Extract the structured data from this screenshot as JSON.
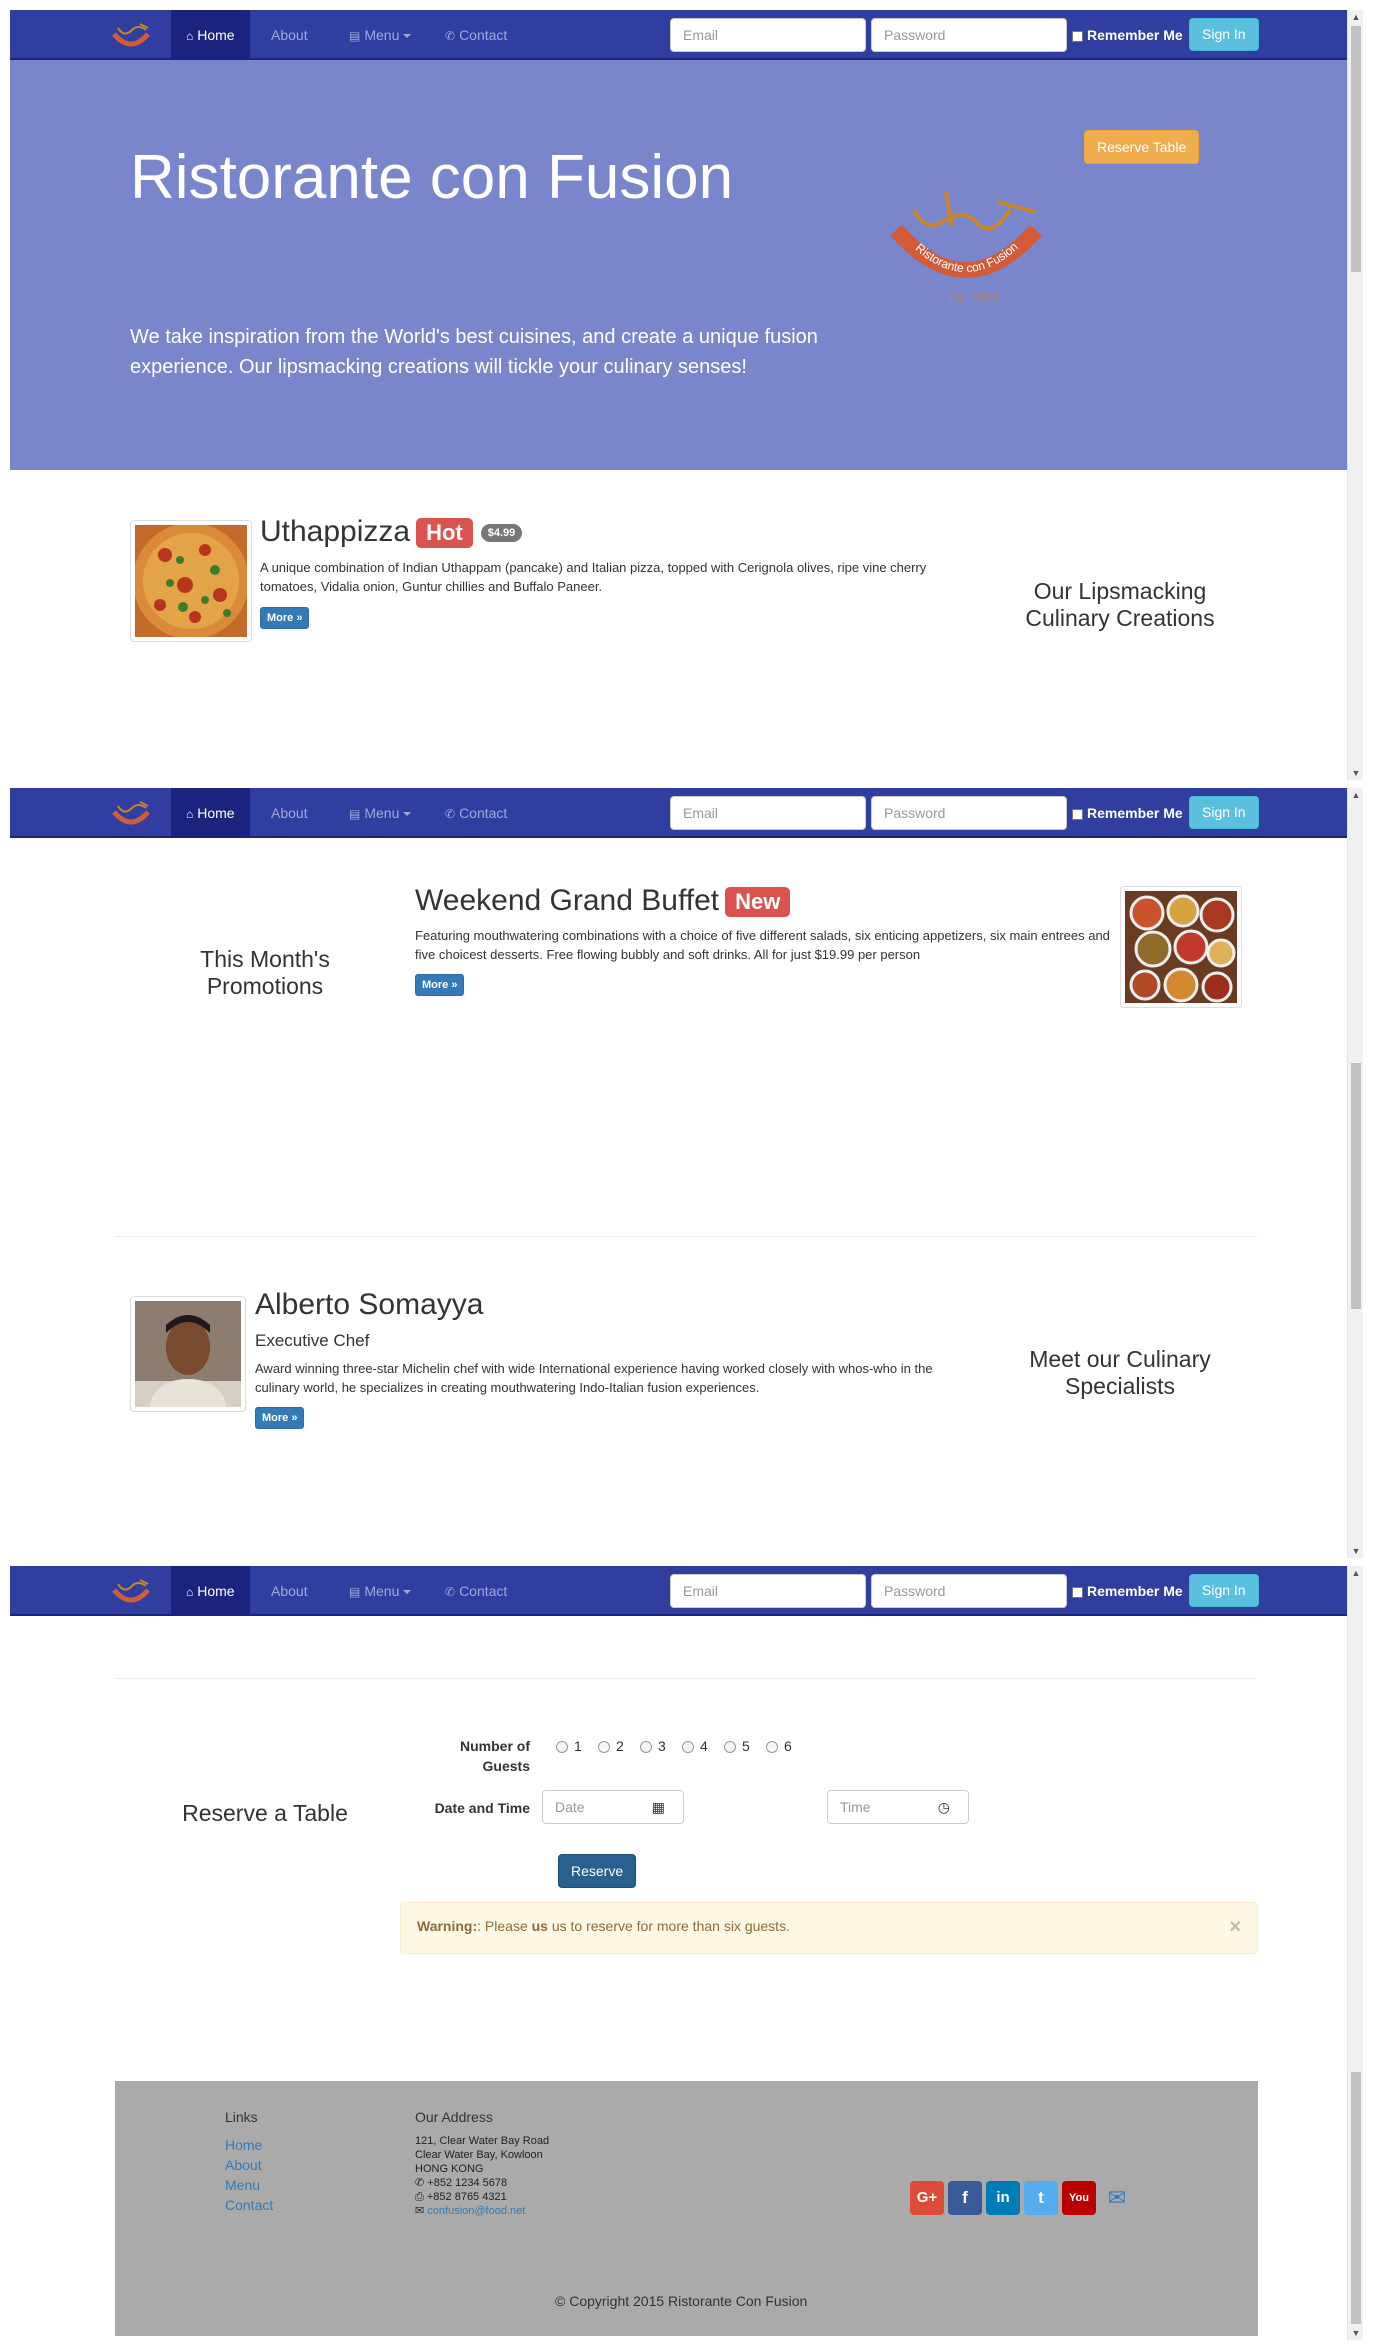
{
  "navbar": {
    "items": [
      {
        "label": "Home",
        "icon": "home-icon",
        "active": true
      },
      {
        "label": "About",
        "icon": "",
        "active": false
      },
      {
        "label": "Menu",
        "icon": "list-icon",
        "active": false
      },
      {
        "label": "Contact",
        "icon": "phone-icon",
        "active": false
      }
    ],
    "email_placeholder": "Email",
    "password_placeholder": "Password",
    "remember_label": "Remember Me",
    "signin_label": "Sign In"
  },
  "jumbotron": {
    "title": "Ristorante con Fusion",
    "description": "We take inspiration from the World's best cuisines, and create a unique fusion experience. Our lipsmacking creations will tickle your culinary senses!",
    "reserve_label": "Reserve Table",
    "logo_text": "Ristorante con Fusion",
    "logo_est": "Est. 2013"
  },
  "dish": {
    "name": "Uthappizza",
    "label": "Hot",
    "price": "$4.99",
    "description": "A unique combination of Indian Uthappam (pancake) and Italian pizza, topped with Cerignola olives, ripe vine cherry tomatoes, Vidalia onion, Guntur chillies and Buffalo Paneer.",
    "more_label": "More »",
    "side_heading": "Our Lipsmacking Culinary Creations"
  },
  "promotion": {
    "name": "Weekend Grand Buffet",
    "label": "New",
    "description": "Featuring mouthwatering combinations with a choice of five different salads, six enticing appetizers, six main entrees and five choicest desserts. Free flowing bubbly and soft drinks. All for just $19.99 per person",
    "more_label": "More »",
    "side_heading": "This Month's Promotions"
  },
  "leader": {
    "name": "Alberto Somayya",
    "designation": "Executive Chef",
    "description": "Award winning three-star Michelin chef with wide International experience having worked closely with whos-who in the culinary world, he specializes in creating mouthwatering Indo-Italian fusion experiences.",
    "more_label": "More »",
    "side_heading": "Meet our Culinary Specialists"
  },
  "reservation": {
    "heading": "Reserve a Table",
    "guests_label": "Number of Guests",
    "guest_options": [
      "1",
      "2",
      "3",
      "4",
      "5",
      "6"
    ],
    "datetime_label": "Date and Time",
    "date_placeholder": "Date",
    "time_placeholder": "Time",
    "submit_label": "Reserve",
    "alert_strong": "Warning:",
    "alert_text_1": ": Please ",
    "alert_bold_2": "us",
    "alert_text_2": " us to reserve for more than six guests.",
    "alert_close": "×"
  },
  "footer": {
    "links_heading": "Links",
    "links": [
      "Home",
      "About",
      "Menu",
      "Contact"
    ],
    "address_heading": "Our Address",
    "address_lines": [
      "121, Clear Water Bay Road",
      "Clear Water Bay, Kowloon",
      "HONG KONG"
    ],
    "phone": "+852 1234 5678",
    "fax": "+852 8765 4321",
    "email": "confusion@food.net",
    "social": [
      {
        "name": "google-plus",
        "glyph": "G+",
        "color": "#dd4b39"
      },
      {
        "name": "facebook",
        "glyph": "f",
        "color": "#3b5998"
      },
      {
        "name": "linkedin",
        "glyph": "in",
        "color": "#007bb6"
      },
      {
        "name": "twitter",
        "glyph": "t",
        "color": "#55acee"
      },
      {
        "name": "youtube",
        "glyph": "You",
        "color": "#bb0000"
      }
    ],
    "copyright": "© Copyright 2015 Ristorante Con Fusion"
  },
  "colors": {
    "navbar": "#303f9f",
    "navbar_active": "#1a237e",
    "jumbotron": "#7986cb",
    "footer": "#aaaaaa",
    "warning_btn": "#f0ad4e",
    "info_btn": "#5bc0de",
    "primary_btn": "#337ab7",
    "danger_label": "#d9534f"
  }
}
